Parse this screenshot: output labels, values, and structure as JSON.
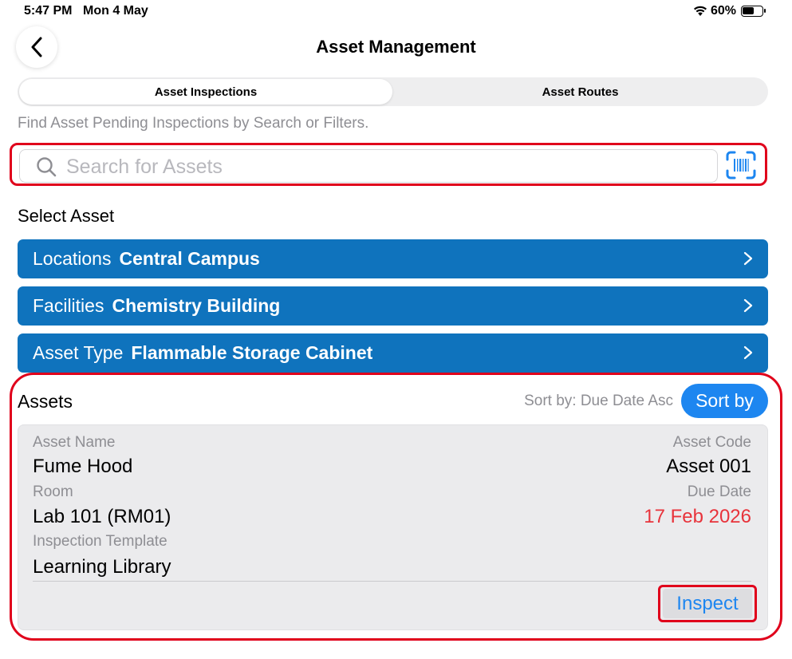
{
  "status_bar": {
    "time": "5:47 PM",
    "date": "Mon 4 May",
    "battery": "60%"
  },
  "header": {
    "title": "Asset Management",
    "back_icon": "chevron-left-icon"
  },
  "tabs": [
    {
      "label": "Asset Inspections",
      "active": true
    },
    {
      "label": "Asset Routes",
      "active": false
    }
  ],
  "hint": "Find Asset Pending Inspections by Search or Filters.",
  "search": {
    "placeholder": "Search for Assets",
    "value": "",
    "scan_icon": "barcode-scan-icon"
  },
  "select_asset": {
    "heading": "Select Asset",
    "filters": [
      {
        "label": "Locations",
        "value": "Central Campus"
      },
      {
        "label": "Facilities",
        "value": "Chemistry Building"
      },
      {
        "label": "Asset Type",
        "value": "Flammable Storage Cabinet"
      }
    ]
  },
  "assets": {
    "heading": "Assets",
    "sort_info": "Sort by: Due Date Asc",
    "sort_button": "Sort by",
    "items": [
      {
        "asset_name_label": "Asset Name",
        "asset_name": "Fume Hood",
        "asset_code_label": "Asset Code",
        "asset_code": "Asset 001",
        "room_label": "Room",
        "room": "Lab 101 (RM01)",
        "due_date_label": "Due Date",
        "due_date": "17 Feb 2026",
        "template_label": "Inspection Template",
        "template": "Learning Library",
        "inspect_label": "Inspect"
      }
    ]
  },
  "colors": {
    "accent": "#1d86f0",
    "filter_bar": "#0f73bd",
    "due_date": "#e8333b",
    "highlight_outline": "#e0001b"
  }
}
